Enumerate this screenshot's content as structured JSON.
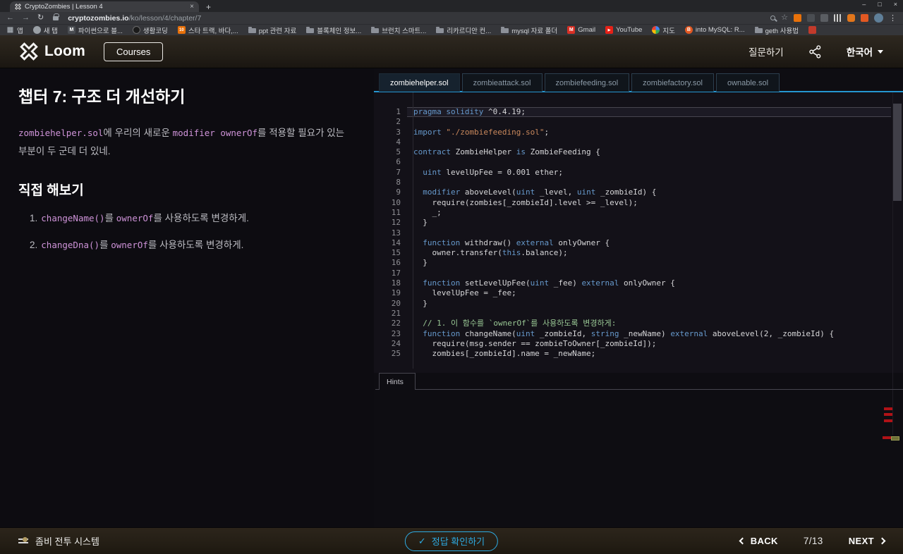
{
  "colors": {
    "accent_blue": "#2596d1",
    "code_keyword": "#6699cc",
    "code_string": "#c9885c",
    "code_comment": "#99c794",
    "inline_code": "#ce93d8",
    "button_blue": "#2da9e0",
    "error_mark": "#b01217"
  },
  "browser": {
    "tab_title": "CryptoZombies | Lesson 4",
    "close_tab": "×",
    "new_tab": "+",
    "window_controls": {
      "minimize": "–",
      "maximize": "□",
      "close": "×"
    },
    "back": "←",
    "forward": "→",
    "refresh": "↻",
    "star": "☆",
    "menu": "⋮",
    "apps_glyph": "▦",
    "url_domain": "cryptozombies.io",
    "url_path": "/ko/lesson/4/chapter/7",
    "bookmarks": [
      {
        "label": "앱",
        "icon": "apps-grid"
      },
      {
        "label": "새 탭",
        "icon": "globe"
      },
      {
        "label": "파이썬으로 블...",
        "icon": "m-badge",
        "glyph": "M"
      },
      {
        "label": "생활코딩",
        "icon": "dark-circle"
      },
      {
        "label": "스타 트랙, 바다,...",
        "icon": "ten-badge",
        "glyph": "10"
      },
      {
        "label": "ppt 관련 자료",
        "icon": "folder"
      },
      {
        "label": "블록체인 정보...",
        "icon": "folder"
      },
      {
        "label": "브런치 스마트...",
        "icon": "folder"
      },
      {
        "label": "리카르디안 컨...",
        "icon": "folder"
      },
      {
        "label": "mysql 자료 폴더",
        "icon": "folder"
      },
      {
        "label": "Gmail",
        "icon": "gmail",
        "glyph": "M"
      },
      {
        "label": "YouTube",
        "icon": "youtube",
        "glyph": "▶"
      },
      {
        "label": "지도",
        "icon": "maps"
      },
      {
        "label": "into MySQL: R...",
        "icon": "b-badge",
        "glyph": "B"
      },
      {
        "label": "geth 사용법",
        "icon": "folder"
      },
      {
        "label": "",
        "icon": "red-cut"
      }
    ]
  },
  "header": {
    "brand": "Loom",
    "courses_label": "Courses",
    "ask_label": "질문하기",
    "language_label": "한국어"
  },
  "lesson": {
    "title": "챕터 7: 구조 더 개선하기",
    "intro_segments": [
      [
        "code",
        "zombiehelper.sol"
      ],
      [
        "text",
        "에 우리의 새로운 "
      ],
      [
        "code",
        "modifier ownerOf"
      ],
      [
        "text",
        "를 적용할 필요가 있는 부분이 두 군데 더 있네."
      ]
    ],
    "try_heading": "직접 해보기",
    "tasks": [
      {
        "num": "1.",
        "segments": [
          [
            "code",
            "changeName()"
          ],
          [
            "text",
            "를 "
          ],
          [
            "code",
            "ownerOf"
          ],
          [
            "text",
            "를 사용하도록 변경하게."
          ]
        ]
      },
      {
        "num": "2.",
        "segments": [
          [
            "code",
            "changeDna()"
          ],
          [
            "text",
            "를 "
          ],
          [
            "code",
            "ownerOf"
          ],
          [
            "text",
            "를 사용하도록 변경하게."
          ]
        ]
      }
    ]
  },
  "editor": {
    "tabs": [
      {
        "label": "zombiehelper.sol",
        "active": true
      },
      {
        "label": "zombieattack.sol",
        "active": false
      },
      {
        "label": "zombiefeeding.sol",
        "active": false
      },
      {
        "label": "zombiefactory.sol",
        "active": false
      },
      {
        "label": "ownable.sol",
        "active": false
      }
    ],
    "hints_label": "Hints",
    "code_lines": [
      {
        "n": 1,
        "hl": true,
        "seg": [
          [
            "kw",
            "pragma"
          ],
          [
            "txt",
            " "
          ],
          [
            "kw",
            "solidity"
          ],
          [
            "txt",
            " ^0.4.19;"
          ]
        ]
      },
      {
        "n": 2,
        "seg": []
      },
      {
        "n": 3,
        "seg": [
          [
            "kw",
            "import"
          ],
          [
            "txt",
            " "
          ],
          [
            "str",
            "\"./zombiefeeding.sol\""
          ],
          [
            "txt",
            ";"
          ]
        ]
      },
      {
        "n": 4,
        "seg": []
      },
      {
        "n": 5,
        "seg": [
          [
            "kw",
            "contract"
          ],
          [
            "txt",
            " ZombieHelper "
          ],
          [
            "kw",
            "is"
          ],
          [
            "txt",
            " ZombieFeeding {"
          ]
        ]
      },
      {
        "n": 6,
        "seg": []
      },
      {
        "n": 7,
        "seg": [
          [
            "txt",
            "  "
          ],
          [
            "kw",
            "uint"
          ],
          [
            "txt",
            " levelUpFee = 0.001 ether;"
          ]
        ]
      },
      {
        "n": 8,
        "seg": []
      },
      {
        "n": 9,
        "seg": [
          [
            "txt",
            "  "
          ],
          [
            "kw",
            "modifier"
          ],
          [
            "txt",
            " aboveLevel("
          ],
          [
            "kw",
            "uint"
          ],
          [
            "txt",
            " _level, "
          ],
          [
            "kw",
            "uint"
          ],
          [
            "txt",
            " _zombieId) {"
          ]
        ]
      },
      {
        "n": 10,
        "seg": [
          [
            "txt",
            "    require(zombies[_zombieId].level >= _level);"
          ]
        ]
      },
      {
        "n": 11,
        "seg": [
          [
            "txt",
            "    _;"
          ]
        ]
      },
      {
        "n": 12,
        "seg": [
          [
            "txt",
            "  }"
          ]
        ]
      },
      {
        "n": 13,
        "seg": []
      },
      {
        "n": 14,
        "seg": [
          [
            "txt",
            "  "
          ],
          [
            "kw",
            "function"
          ],
          [
            "txt",
            " withdraw() "
          ],
          [
            "kw",
            "external"
          ],
          [
            "txt",
            " onlyOwner {"
          ]
        ]
      },
      {
        "n": 15,
        "seg": [
          [
            "txt",
            "    owner.transfer("
          ],
          [
            "kw",
            "this"
          ],
          [
            "txt",
            ".balance);"
          ]
        ]
      },
      {
        "n": 16,
        "seg": [
          [
            "txt",
            "  }"
          ]
        ]
      },
      {
        "n": 17,
        "seg": []
      },
      {
        "n": 18,
        "seg": [
          [
            "txt",
            "  "
          ],
          [
            "kw",
            "function"
          ],
          [
            "txt",
            " setLevelUpFee("
          ],
          [
            "kw",
            "uint"
          ],
          [
            "txt",
            " _fee) "
          ],
          [
            "kw",
            "external"
          ],
          [
            "txt",
            " onlyOwner {"
          ]
        ]
      },
      {
        "n": 19,
        "seg": [
          [
            "txt",
            "    levelUpFee = _fee;"
          ]
        ]
      },
      {
        "n": 20,
        "seg": [
          [
            "txt",
            "  }"
          ]
        ]
      },
      {
        "n": 21,
        "seg": []
      },
      {
        "n": 22,
        "seg": [
          [
            "cmt",
            "  // 1. 이 함수를 `ownerOf`를 사용하도록 변경하게:"
          ]
        ]
      },
      {
        "n": 23,
        "seg": [
          [
            "txt",
            "  "
          ],
          [
            "kw",
            "function"
          ],
          [
            "txt",
            " changeName("
          ],
          [
            "kw",
            "uint"
          ],
          [
            "txt",
            " _zombieId, "
          ],
          [
            "kw",
            "string"
          ],
          [
            "txt",
            " _newName) "
          ],
          [
            "kw",
            "external"
          ],
          [
            "txt",
            " aboveLevel(2, _zombieId) {"
          ]
        ]
      },
      {
        "n": 24,
        "seg": [
          [
            "txt",
            "    require(msg.sender == zombieToOwner[_zombieId]);"
          ]
        ]
      },
      {
        "n": 25,
        "seg": [
          [
            "txt",
            "    zombies[_zombieId].name = _newName;"
          ]
        ]
      }
    ]
  },
  "footer": {
    "course_title": "좀비 전투 시스템",
    "check_label": "정답 확인하기",
    "check_mark": "✓",
    "back_label": "BACK",
    "progress": "7/13",
    "next_label": "NEXT"
  }
}
